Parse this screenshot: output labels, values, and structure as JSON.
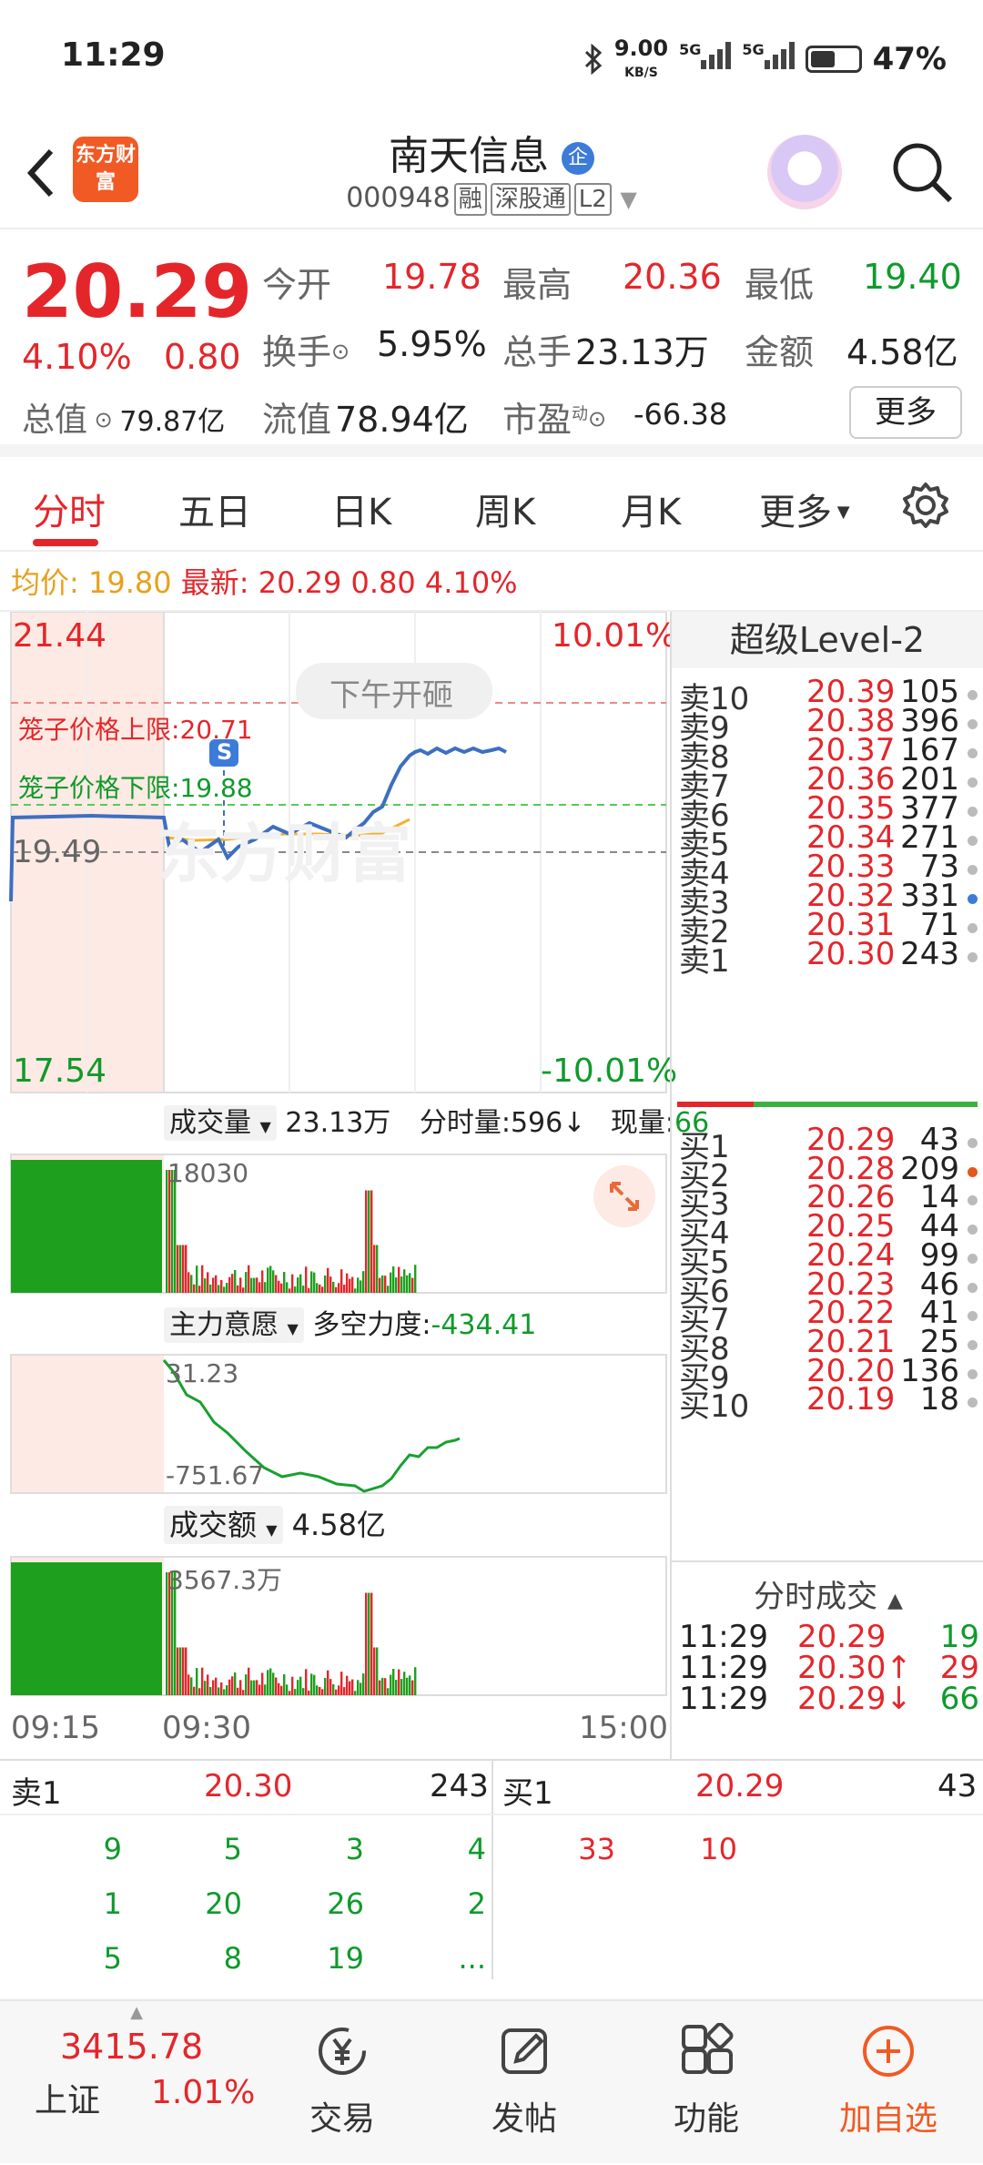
{
  "status": {
    "time": "11:29",
    "net_speed": "9.00",
    "net_unit": "KB/S",
    "net1": "5G",
    "net2": "5G",
    "battery": "47%"
  },
  "header": {
    "logo": "东方财富",
    "title": "南天信息",
    "title_badge": "企",
    "code": "000948",
    "tags": [
      "融",
      "深股通",
      "L2"
    ]
  },
  "quote": {
    "price": "20.29",
    "change_pct": "4.10%",
    "change": "0.80",
    "open_label": "今开",
    "open": "19.78",
    "high_label": "最高",
    "high": "20.36",
    "low_label": "最低",
    "low": "19.40",
    "turnover_label": "换手",
    "turnover": "5.95%",
    "volume_label": "总手",
    "volume": "23.13万",
    "amount_label": "金额",
    "amount": "4.58亿",
    "mcap_label": "总值",
    "mcap": "79.87亿",
    "float_label": "流值",
    "float": "78.94亿",
    "pe_label": "市盈",
    "pe_sup": "动",
    "pe": "-66.38",
    "more": "更多"
  },
  "tabs": [
    "分时",
    "五日",
    "日K",
    "周K",
    "月K",
    "更多"
  ],
  "avgbar": {
    "avg_label": "均价:",
    "avg": "19.80",
    "last_label": "最新:",
    "last": "20.29",
    "chg": "0.80",
    "pct": "4.10%"
  },
  "chart": {
    "y_top": "21.44",
    "pct_top": "10.01%",
    "y_mid": "19.49",
    "y_bot": "17.54",
    "pct_bot": "-10.01%",
    "midday": "下午开砸",
    "cage_up_label": "笼子价格上限:",
    "cage_up": "20.71",
    "cage_down_label": "笼子价格下限:",
    "cage_down": "19.88",
    "s_marker": "S",
    "vol_label": "成交量",
    "vol_total": "23.13万",
    "vol_tick_label": "分时量:",
    "vol_tick": "596↓",
    "vol_now_label": "现量:",
    "vol_now": "66",
    "vol_max": "18030",
    "ind_label": "主力意愿",
    "ind_sub_label": "多空力度:",
    "ind_value": "-434.41",
    "ind_top": "31.23",
    "ind_bot": "-751.67",
    "amt_label": "成交额",
    "amt_total": "4.58亿",
    "amt_max": "3567.3万",
    "t_start": "09:15",
    "t_open": "09:30",
    "t_end": "15:00",
    "watermark": "东方财富"
  },
  "level2": {
    "title": "超级Level-2",
    "asks": [
      [
        "卖10",
        "20.39",
        "105"
      ],
      [
        "卖9",
        "20.38",
        "396"
      ],
      [
        "卖8",
        "20.37",
        "167"
      ],
      [
        "卖7",
        "20.36",
        "201"
      ],
      [
        "卖6",
        "20.35",
        "377"
      ],
      [
        "卖5",
        "20.34",
        "271"
      ],
      [
        "卖4",
        "20.33",
        "73"
      ],
      [
        "卖3",
        "20.32",
        "331"
      ],
      [
        "卖2",
        "20.31",
        "71"
      ],
      [
        "卖1",
        "20.30",
        "243"
      ]
    ],
    "bids": [
      [
        "买1",
        "20.29",
        "43"
      ],
      [
        "买2",
        "20.28",
        "209"
      ],
      [
        "买3",
        "20.26",
        "14"
      ],
      [
        "买4",
        "20.25",
        "44"
      ],
      [
        "买5",
        "20.24",
        "99"
      ],
      [
        "买6",
        "20.23",
        "46"
      ],
      [
        "买7",
        "20.22",
        "41"
      ],
      [
        "买8",
        "20.21",
        "25"
      ],
      [
        "买9",
        "20.20",
        "136"
      ],
      [
        "买10",
        "20.19",
        "18"
      ]
    ],
    "trades_title": "分时成交",
    "trades": [
      [
        "11:29",
        "20.29",
        "19"
      ],
      [
        "11:29",
        "20.30↑",
        "29"
      ],
      [
        "11:29",
        "20.29↓",
        "66"
      ]
    ]
  },
  "book": {
    "ask_label": "卖1",
    "ask_price": "20.30",
    "ask_vol": "243",
    "bid_label": "买1",
    "bid_price": "20.29",
    "bid_vol": "43",
    "ask_queue": [
      [
        "9",
        "5",
        "3",
        "4"
      ],
      [
        "1",
        "20",
        "26",
        "2"
      ],
      [
        "5",
        "8",
        "19",
        "..."
      ]
    ],
    "bid_queue": [
      "33",
      "10"
    ]
  },
  "nav": {
    "index_value": "3415.78",
    "index_name": "上证",
    "index_pct": "1.01%",
    "items": [
      "交易",
      "发帖",
      "功能",
      "加自选"
    ]
  },
  "colors": {
    "up": "#e4262b",
    "down": "#109a2c",
    "accent": "#f15a24",
    "price_line": "#3d6fc0",
    "avg_line": "#f2b230"
  }
}
